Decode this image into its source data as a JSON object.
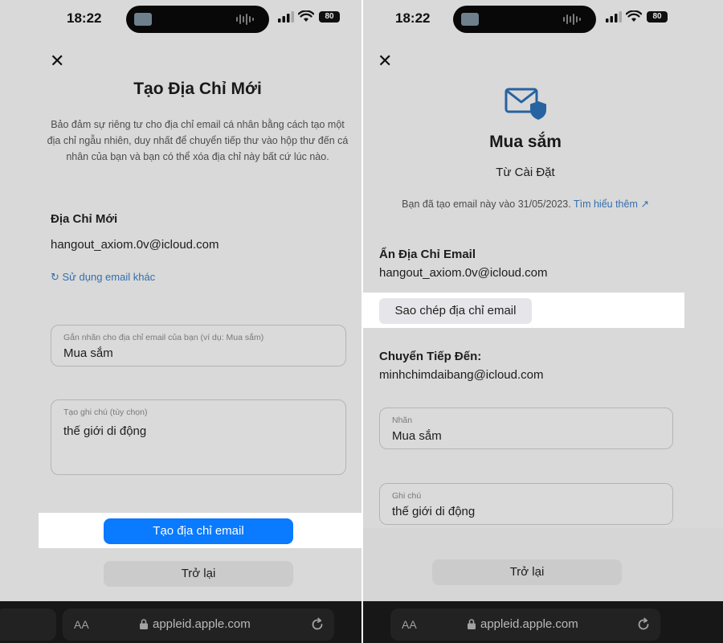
{
  "status": {
    "time": "18:22",
    "battery": "80"
  },
  "left": {
    "title": "Tạo Địa Chỉ Mới",
    "description": "Bảo đảm sự riêng tư cho địa chỉ email cá nhân bằng cách tạo một địa chỉ ngẫu nhiên, duy nhất để chuyển tiếp thư vào hộp thư đến cá nhân của bạn và bạn có thể xóa địa chỉ này bất cứ lúc nào.",
    "new_address_label": "Địa Chỉ Mới",
    "new_address_value": "hangout_axiom.0v@icloud.com",
    "use_other_link": "Sử dụng email khác",
    "label_field": {
      "label": "Gắn nhãn cho địa chỉ email của bạn (ví dụ: Mua sắm)",
      "value": "Mua sắm"
    },
    "note_field": {
      "label": "Tạo ghi chú (tùy chọn)",
      "value": "thế giới di động"
    },
    "create_button": "Tạo địa chỉ email",
    "back_button": "Trở lại",
    "url": "appleid.apple.com",
    "aa": "AA"
  },
  "right": {
    "title": "Mua sắm",
    "subtitle": "Từ Cài Đặt",
    "created_text": "Bạn đã tạo email này vào 31/05/2023.",
    "learn_more": "Tìm hiểu thêm ↗",
    "hide_email_label": "Ẩn Địa Chỉ Email",
    "hide_email_value": "hangout_axiom.0v@icloud.com",
    "copy_button": "Sao chép địa chỉ email",
    "forward_label": "Chuyển Tiếp Đến:",
    "forward_value": "minhchimdaibang@icloud.com",
    "label_field": {
      "label": "Nhãn",
      "value": "Mua sắm"
    },
    "note_field": {
      "label": "Ghi chú",
      "value": "thế giới di động"
    },
    "back_button": "Trở lại",
    "url": "appleid.apple.com",
    "aa": "AA"
  },
  "colors": {
    "accent": "#0a7aff",
    "link": "#3a7bc0",
    "icon": "#2c6fb3"
  }
}
